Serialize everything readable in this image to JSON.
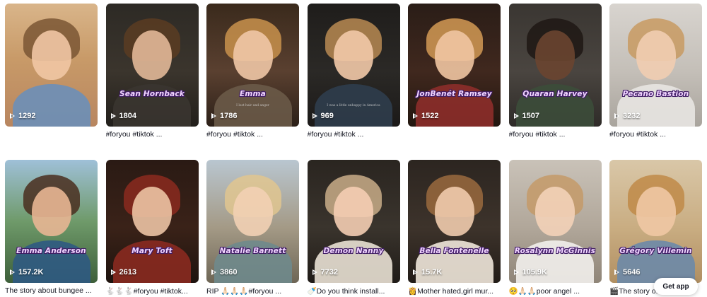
{
  "colors": {
    "text": "#161823",
    "name_fill": "#f2d7ff",
    "name_outline": "#3a1a5c"
  },
  "videos": [
    {
      "name": "",
      "caption": "",
      "views": "1292",
      "desc": "",
      "bg": "linear-gradient(180deg,#d9b58a 0%,#c89a68 45%,#b88660 100%)",
      "hair": "#7a5634",
      "face": "#f1c6a4",
      "body": "#6b8fb8"
    },
    {
      "name": "Sean Hornback",
      "caption": "",
      "views": "1804",
      "desc": "#foryou #tiktok ...",
      "bg": "linear-gradient(180deg,#2d2a25 0%,#3b352d 55%,#221f1b 100%)",
      "hair": "#5a3c22",
      "face": "#e2b898",
      "body": "#3a3530"
    },
    {
      "name": "Emma",
      "caption": "I lost hair and anger",
      "views": "1786",
      "desc": "#foryou #tiktok ...",
      "bg": "linear-gradient(180deg,#3a2a1c 0%,#5a4030 55%,#2c2018 100%)",
      "hair": "#c9924c",
      "face": "#f0c6a6",
      "body": "#6a5a48"
    },
    {
      "name": "",
      "caption": "I was a little unhappy in America",
      "views": "969",
      "desc": "#foryou #tiktok ...",
      "bg": "linear-gradient(180deg,#1f1d1b 0%,#2b2926 55%,#1b1918 100%)",
      "hair": "#b88a52",
      "face": "#f2c9a8",
      "body": "#2f3d4c"
    },
    {
      "name": "JonBenét Ramsey",
      "caption": "",
      "views": "1522",
      "desc": "",
      "bg": "linear-gradient(180deg,#2a1d17 0%,#40281e 55%,#22160f 100%)",
      "hair": "#d39a55",
      "face": "#f0c5a2",
      "body": "#8d2e2a"
    },
    {
      "name": "Quaran Harvey",
      "caption": "",
      "views": "1507",
      "desc": "#foryou #tiktok ...",
      "bg": "linear-gradient(180deg,#3a3632 0%,#4a4540 55%,#2e2b28 100%)",
      "hair": "#1e1714",
      "face": "#6a4530",
      "body": "#3c4c3a"
    },
    {
      "name": "Pecano Bastion",
      "caption": "",
      "views": "3232",
      "desc": "#foryou #tiktok ...",
      "bg": "linear-gradient(180deg,#d8d4cf 0%,#c4bfb8 55%,#a9a49d 100%)",
      "hair": "#c89a62",
      "face": "#f1cdb1",
      "body": "#e8e6e2"
    },
    {
      "name": "Emma Anderson",
      "caption": "",
      "views": "157.2K",
      "desc": "The story about bungee ...",
      "bg": "linear-gradient(180deg,#9fc0d8 0%,#6f9a6a 50%,#3d5f3a 100%)",
      "hair": "#4a2e1e",
      "face": "#e8b694",
      "body": "#2f5a82"
    },
    {
      "name": "Mary Toft",
      "caption": "",
      "views": "2613",
      "desc": "🐇🐇🐇#foryou #tiktok...",
      "bg": "linear-gradient(180deg,#2a1a14 0%,#3a2218 55%,#1e130e 100%)",
      "hair": "#8b2a1e",
      "face": "#ecc3a4",
      "body": "#8a2a20"
    },
    {
      "name": "Natalie Barnett",
      "caption": "",
      "views": "3860",
      "desc": "RIP 🙏🏻🙏🏻🙏🏻#foryou ...",
      "bg": "linear-gradient(180deg,#b9c6d0 0%,#a49a86 55%,#6e6656 100%)",
      "hair": "#e0c58f",
      "face": "#f2d0b4",
      "body": "#6f8a8c"
    },
    {
      "name": "Demon Nanny",
      "caption": "",
      "views": "7732",
      "desc": "🍼Do you think install...",
      "bg": "linear-gradient(180deg,#2a2520 0%,#3a342d 55%,#1f1b17 100%)",
      "hair": "#c9ad88",
      "face": "#f4cdb2",
      "body": "#e9e1d4"
    },
    {
      "name": "Bella Fontenelle",
      "caption": "",
      "views": "15.7K",
      "desc": "👸Mother hated,girl mur...",
      "bg": "linear-gradient(180deg,#2c2520 0%,#3d332b 55%,#221c17 100%)",
      "hair": "#9a6a3e",
      "face": "#f0cbad",
      "body": "#efe7da"
    },
    {
      "name": "Rosalynn McGinnis",
      "caption": "",
      "views": "105.9K",
      "desc": "🥺🙏🏻🙏🏻poor angel ...",
      "bg": "linear-gradient(180deg,#c9c2b8 0%,#b1a79a 55%,#8f8578 100%)",
      "hair": "#c49a68",
      "face": "#f3d2b8",
      "body": "#f2f0ec"
    },
    {
      "name": "Grégory Villemin",
      "caption": "",
      "views": "5646",
      "desc": "🎬The story o...",
      "bg": "linear-gradient(180deg,#d9c7a8 0%,#c9ad82 55%,#b08f62 100%)",
      "hair": "#c08a48",
      "face": "#f0c8a4",
      "body": "#6d8aa8"
    }
  ],
  "get_app": "Get app"
}
